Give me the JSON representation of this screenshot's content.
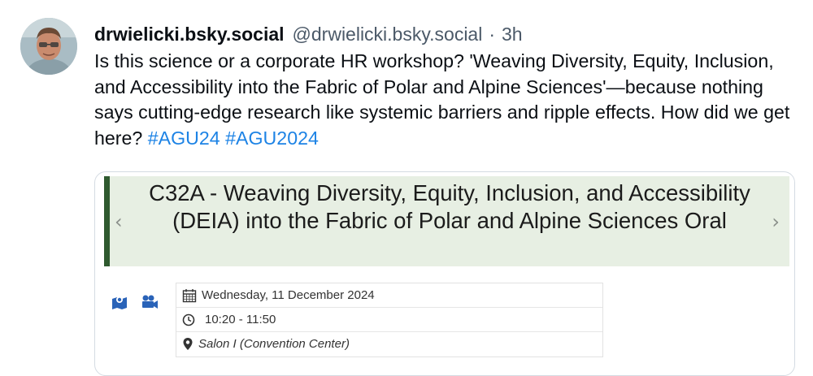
{
  "author": {
    "display_name": "drwielicki.bsky.social",
    "handle": "@drwielicki.bsky.social",
    "separator": "·",
    "time_ago": "3h",
    "avatar_icon": "user-avatar"
  },
  "post": {
    "text": "Is this science or a corporate HR workshop? 'Weaving Diversity, Equity, Inclusion, and Accessibility into the Fabric of Polar and Alpine Sciences'—because nothing says cutting-edge research like systemic barriers and ripple effects. How did we get here?",
    "hashtags": [
      "#AGU24",
      "#AGU2024"
    ]
  },
  "embed": {
    "title": "C32A - Weaving Diversity, Equity, Inclusion, and Accessibility (DEIA) into the Fabric of Polar and Alpine Sciences Oral",
    "prev_icon": "chevron-left-icon",
    "next_icon": "chevron-right-icon",
    "date": "Wednesday, 11 December 2024",
    "time_range": "10:20 - 11:50",
    "location": "Salon I (Convention Center)",
    "accent_color": "#2f5a2f",
    "banner_bg": "#e7efe3",
    "icon_color": "#2a63b8"
  },
  "colors": {
    "hashtag": "#1d83e5",
    "muted": "#4b5968"
  }
}
